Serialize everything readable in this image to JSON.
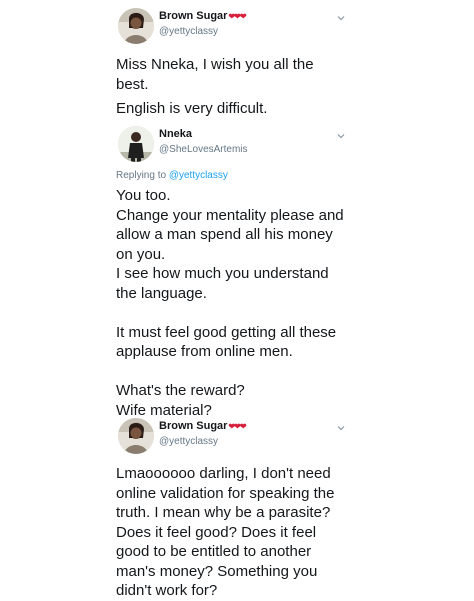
{
  "tweets": [
    {
      "display_name": "Brown Sugar",
      "handle": "@yettyclassy",
      "name_decoration": "❤❤❤",
      "lines": [
        "Miss Nneka, I wish you all the",
        "best.",
        "English is very difficult."
      ]
    },
    {
      "display_name": "Nneka",
      "handle": "@SheLovesArtemis",
      "replying_prefix": "Replying to",
      "replying_to": "@yettyclassy",
      "lines": [
        "You too.",
        "Change your mentality please and",
        "allow a man spend all his money",
        "on you.",
        "I see how much you understand",
        "the language.",
        "",
        "It must feel good getting all these",
        "applause from online men.",
        "",
        "What's the reward?",
        "Wife material?"
      ]
    },
    {
      "display_name": "Brown Sugar",
      "handle": "@yettyclassy",
      "name_decoration": "❤❤❤",
      "lines": [
        "Lmaoooooo darling, I don't need",
        "online validation for speaking the",
        "truth. I mean why be a parasite?",
        "Does it feel good? Does it feel",
        "good to be entitled to another",
        "man's money? Something you",
        "didn't work for?"
      ]
    }
  ],
  "colors": {
    "text": "#14171a",
    "secondary": "#657786",
    "link": "#1da1f2",
    "heart": "#d61f3a"
  },
  "icons": [
    "avatar",
    "chevron-down-icon",
    "heart-icon"
  ]
}
